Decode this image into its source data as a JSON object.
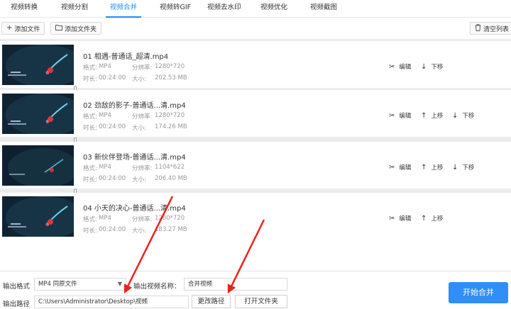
{
  "tabs": [
    {
      "label": "视频转换"
    },
    {
      "label": "视频分割"
    },
    {
      "label": "视频合并",
      "active": true
    },
    {
      "label": "视频转GIF"
    },
    {
      "label": "视频去水印"
    },
    {
      "label": "视频优化"
    },
    {
      "label": "视频截图"
    }
  ],
  "toolbar": {
    "add_file": "添加文件",
    "add_folder": "添加文件夹",
    "clear_list": "清空列表"
  },
  "meta_labels": {
    "format": "格式:",
    "resolution": "分辨率:",
    "duration": "时长:",
    "size": "大小:"
  },
  "actions": {
    "edit": "编辑",
    "up": "上移",
    "down": "下移"
  },
  "files": [
    {
      "name": "01 相遇-普通话_超清.mp4",
      "format": "MP4",
      "resolution": "1280*720",
      "duration": "00:24:00",
      "size": "202.53 MB"
    },
    {
      "name": "02 劲敌的影子-普通话...清.mp4",
      "format": "MP4",
      "resolution": "1280*720",
      "duration": "00:24:00",
      "size": "174.26 MB"
    },
    {
      "name": "03 新伙伴登场-普通话...清.mp4",
      "format": "MP4",
      "resolution": "1104*622",
      "duration": "00:24:00",
      "size": "206.40 MB"
    },
    {
      "name": "04 小天的决心-普通话...清.mp4",
      "format": "MP4",
      "resolution": "1280*720",
      "duration": "00:24:00",
      "size": "183.27 MB"
    }
  ],
  "output": {
    "format_label": "输出格式",
    "format_value": "MP4  同原文件",
    "name_label": "输出视频名称：",
    "name_value": "合并视频",
    "path_label": "输出路径",
    "path_value": "C:\\Users\\Administrator\\Desktop\\视频",
    "change_path": "更改路径",
    "open_folder": "打开文件夹",
    "start": "开始合并"
  },
  "colors": {
    "accent": "#1a8cff",
    "start_button": "#2f8ff7",
    "annotation_arrow": "#e8231e"
  }
}
